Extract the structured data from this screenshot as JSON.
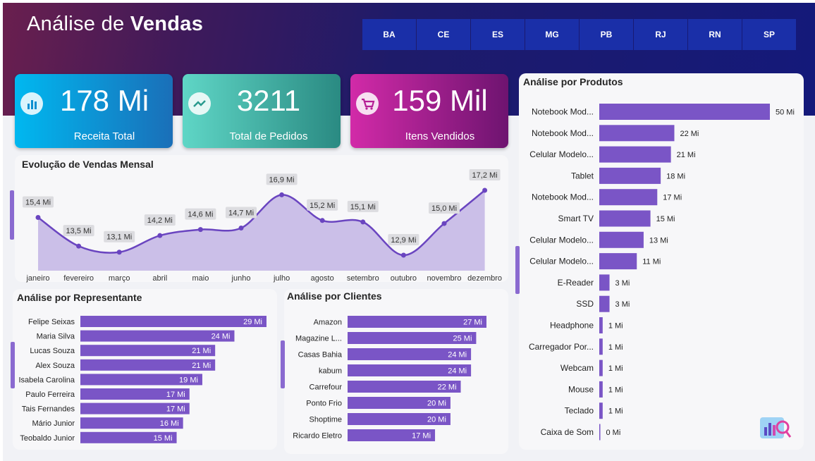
{
  "header": {
    "title_part1": "Análise de ",
    "title_part2": "Vendas"
  },
  "states": [
    "BA",
    "CE",
    "ES",
    "MG",
    "PB",
    "RJ",
    "RN",
    "SP"
  ],
  "kpis": [
    {
      "value": "178 Mi",
      "label": "Receita Total",
      "icon": "bar-chart-icon"
    },
    {
      "value": "3211",
      "label": "Total de Pedidos",
      "icon": "handshake-icon"
    },
    {
      "value": "159 Mil",
      "label": "Itens Vendidos",
      "icon": "shopping-cart-icon"
    }
  ],
  "colors": {
    "bar": "#7a55c6",
    "area": "#cbbfe8",
    "line": "#6a45c0",
    "kpi1": "#0aa7e0",
    "kpi2": "#3fb5a8",
    "kpi3": "#c01f9a"
  },
  "monthly": {
    "title": "Evolução de Vendas Mensal",
    "chart_data": {
      "type": "area",
      "categories": [
        "janeiro",
        "fevereiro",
        "março",
        "abril",
        "maio",
        "junho",
        "julho",
        "agosto",
        "setembro",
        "outubro",
        "novembro",
        "dezembro"
      ],
      "values": [
        15.4,
        13.5,
        13.1,
        14.2,
        14.6,
        14.7,
        16.9,
        15.2,
        15.1,
        12.9,
        15.0,
        17.2
      ],
      "labels": [
        "15,4 Mi",
        "13,5 Mi",
        "13,1 Mi",
        "14,2 Mi",
        "14,6 Mi",
        "14,7 Mi",
        "16,9 Mi",
        "15,2 Mi",
        "15,1 Mi",
        "12,9 Mi",
        "15,0 Mi",
        "17,2 Mi"
      ]
    }
  },
  "representantes": {
    "title": "Análise por Representante",
    "chart_data": {
      "type": "bar",
      "categories": [
        "Felipe Seixas",
        "Maria Silva",
        "Lucas Souza",
        "Alex Souza",
        "Isabela Carolina",
        "Paulo Ferreira",
        "Tais Fernandes",
        "Mário Junior",
        "Teobaldo Junior"
      ],
      "values": [
        29,
        24,
        21,
        21,
        19,
        17,
        17,
        16,
        15
      ],
      "labels": [
        "29 Mi",
        "24 Mi",
        "21 Mi",
        "21 Mi",
        "19 Mi",
        "17 Mi",
        "17 Mi",
        "16 Mi",
        "15 Mi"
      ]
    }
  },
  "clientes": {
    "title": "Análise por Clientes",
    "chart_data": {
      "type": "bar",
      "categories": [
        "Amazon",
        "Magazine L...",
        "Casas Bahia",
        "kabum",
        "Carrefour",
        "Ponto Frio",
        "Shoptime",
        "Ricardo Eletro"
      ],
      "values": [
        27,
        25,
        24,
        24,
        22,
        20,
        20,
        17
      ],
      "labels": [
        "27 Mi",
        "25 Mi",
        "24 Mi",
        "24 Mi",
        "22 Mi",
        "20 Mi",
        "20 Mi",
        "17 Mi"
      ]
    }
  },
  "produtos": {
    "title": "Análise por Produtos",
    "chart_data": {
      "type": "bar",
      "categories": [
        "Notebook Mod...",
        "Notebook Mod...",
        "Celular Modelo...",
        "Tablet",
        "Notebook Mod...",
        "Smart TV",
        "Celular Modelo...",
        "Celular Modelo...",
        "E-Reader",
        "SSD",
        "Headphone",
        "Carregador Por...",
        "Webcam",
        "Mouse",
        "Teclado",
        "Caixa de Som"
      ],
      "values": [
        50,
        22,
        21,
        18,
        17,
        15,
        13,
        11,
        3,
        3,
        1,
        1,
        1,
        1,
        1,
        0
      ],
      "labels": [
        "50 Mi",
        "22 Mi",
        "21 Mi",
        "18 Mi",
        "17 Mi",
        "15 Mi",
        "13 Mi",
        "11 Mi",
        "3 Mi",
        "3 Mi",
        "1 Mi",
        "1 Mi",
        "1 Mi",
        "1 Mi",
        "1 Mi",
        "0 Mi"
      ]
    }
  }
}
